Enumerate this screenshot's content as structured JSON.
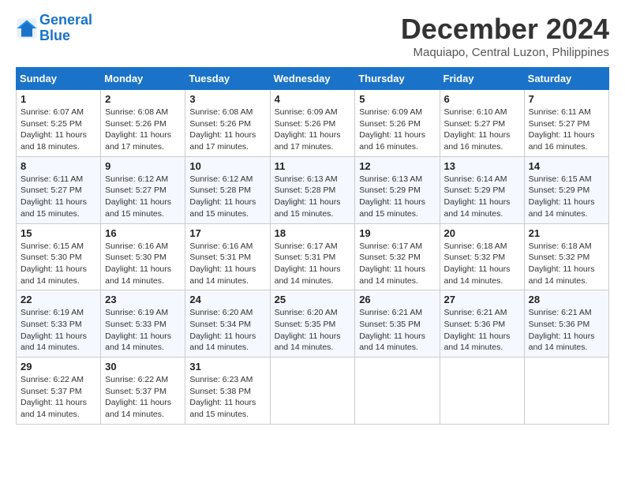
{
  "logo": {
    "line1": "General",
    "line2": "Blue"
  },
  "title": "December 2024",
  "subtitle": "Maquiapo, Central Luzon, Philippines",
  "headers": [
    "Sunday",
    "Monday",
    "Tuesday",
    "Wednesday",
    "Thursday",
    "Friday",
    "Saturday"
  ],
  "weeks": [
    [
      {
        "day": "1",
        "sunrise": "6:07 AM",
        "sunset": "5:25 PM",
        "daylight": "11 hours and 18 minutes."
      },
      {
        "day": "2",
        "sunrise": "6:08 AM",
        "sunset": "5:26 PM",
        "daylight": "11 hours and 17 minutes."
      },
      {
        "day": "3",
        "sunrise": "6:08 AM",
        "sunset": "5:26 PM",
        "daylight": "11 hours and 17 minutes."
      },
      {
        "day": "4",
        "sunrise": "6:09 AM",
        "sunset": "5:26 PM",
        "daylight": "11 hours and 17 minutes."
      },
      {
        "day": "5",
        "sunrise": "6:09 AM",
        "sunset": "5:26 PM",
        "daylight": "11 hours and 16 minutes."
      },
      {
        "day": "6",
        "sunrise": "6:10 AM",
        "sunset": "5:27 PM",
        "daylight": "11 hours and 16 minutes."
      },
      {
        "day": "7",
        "sunrise": "6:11 AM",
        "sunset": "5:27 PM",
        "daylight": "11 hours and 16 minutes."
      }
    ],
    [
      {
        "day": "8",
        "sunrise": "6:11 AM",
        "sunset": "5:27 PM",
        "daylight": "11 hours and 15 minutes."
      },
      {
        "day": "9",
        "sunrise": "6:12 AM",
        "sunset": "5:27 PM",
        "daylight": "11 hours and 15 minutes."
      },
      {
        "day": "10",
        "sunrise": "6:12 AM",
        "sunset": "5:28 PM",
        "daylight": "11 hours and 15 minutes."
      },
      {
        "day": "11",
        "sunrise": "6:13 AM",
        "sunset": "5:28 PM",
        "daylight": "11 hours and 15 minutes."
      },
      {
        "day": "12",
        "sunrise": "6:13 AM",
        "sunset": "5:29 PM",
        "daylight": "11 hours and 15 minutes."
      },
      {
        "day": "13",
        "sunrise": "6:14 AM",
        "sunset": "5:29 PM",
        "daylight": "11 hours and 14 minutes."
      },
      {
        "day": "14",
        "sunrise": "6:15 AM",
        "sunset": "5:29 PM",
        "daylight": "11 hours and 14 minutes."
      }
    ],
    [
      {
        "day": "15",
        "sunrise": "6:15 AM",
        "sunset": "5:30 PM",
        "daylight": "11 hours and 14 minutes."
      },
      {
        "day": "16",
        "sunrise": "6:16 AM",
        "sunset": "5:30 PM",
        "daylight": "11 hours and 14 minutes."
      },
      {
        "day": "17",
        "sunrise": "6:16 AM",
        "sunset": "5:31 PM",
        "daylight": "11 hours and 14 minutes."
      },
      {
        "day": "18",
        "sunrise": "6:17 AM",
        "sunset": "5:31 PM",
        "daylight": "11 hours and 14 minutes."
      },
      {
        "day": "19",
        "sunrise": "6:17 AM",
        "sunset": "5:32 PM",
        "daylight": "11 hours and 14 minutes."
      },
      {
        "day": "20",
        "sunrise": "6:18 AM",
        "sunset": "5:32 PM",
        "daylight": "11 hours and 14 minutes."
      },
      {
        "day": "21",
        "sunrise": "6:18 AM",
        "sunset": "5:32 PM",
        "daylight": "11 hours and 14 minutes."
      }
    ],
    [
      {
        "day": "22",
        "sunrise": "6:19 AM",
        "sunset": "5:33 PM",
        "daylight": "11 hours and 14 minutes."
      },
      {
        "day": "23",
        "sunrise": "6:19 AM",
        "sunset": "5:33 PM",
        "daylight": "11 hours and 14 minutes."
      },
      {
        "day": "24",
        "sunrise": "6:20 AM",
        "sunset": "5:34 PM",
        "daylight": "11 hours and 14 minutes."
      },
      {
        "day": "25",
        "sunrise": "6:20 AM",
        "sunset": "5:35 PM",
        "daylight": "11 hours and 14 minutes."
      },
      {
        "day": "26",
        "sunrise": "6:21 AM",
        "sunset": "5:35 PM",
        "daylight": "11 hours and 14 minutes."
      },
      {
        "day": "27",
        "sunrise": "6:21 AM",
        "sunset": "5:36 PM",
        "daylight": "11 hours and 14 minutes."
      },
      {
        "day": "28",
        "sunrise": "6:21 AM",
        "sunset": "5:36 PM",
        "daylight": "11 hours and 14 minutes."
      }
    ],
    [
      {
        "day": "29",
        "sunrise": "6:22 AM",
        "sunset": "5:37 PM",
        "daylight": "11 hours and 14 minutes."
      },
      {
        "day": "30",
        "sunrise": "6:22 AM",
        "sunset": "5:37 PM",
        "daylight": "11 hours and 14 minutes."
      },
      {
        "day": "31",
        "sunrise": "6:23 AM",
        "sunset": "5:38 PM",
        "daylight": "11 hours and 15 minutes."
      },
      null,
      null,
      null,
      null
    ]
  ],
  "labels": {
    "sunrise": "Sunrise:",
    "sunset": "Sunset:",
    "daylight": "Daylight:"
  }
}
